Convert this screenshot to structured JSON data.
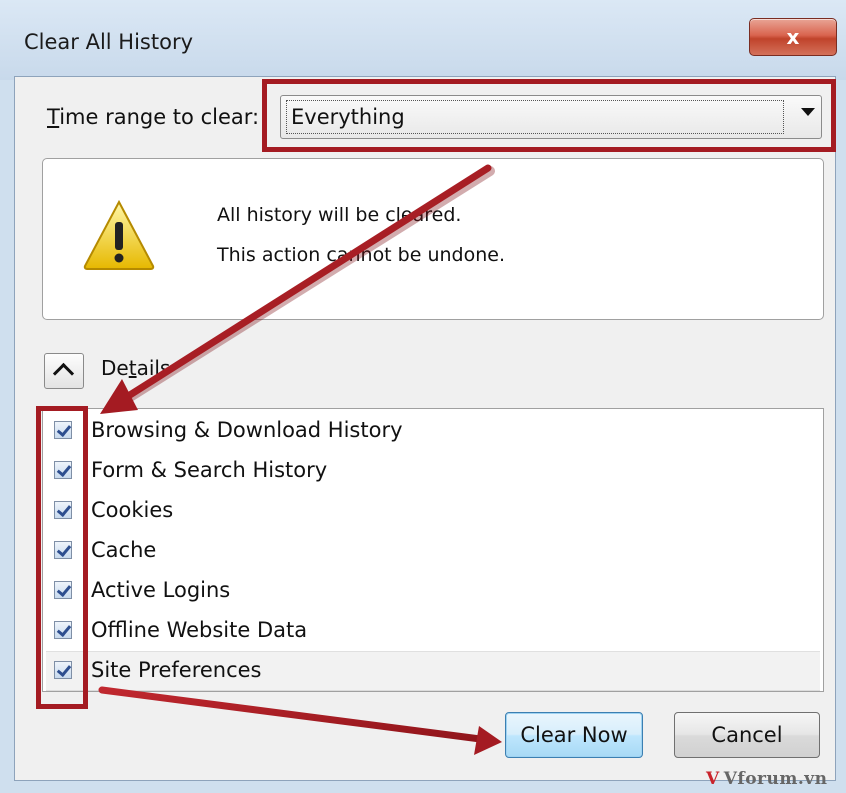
{
  "window": {
    "title": "Clear All History",
    "close_symbol": "x"
  },
  "time_range": {
    "label_prefix": "T",
    "label_rest": "ime range to clear:",
    "selected": "Everything"
  },
  "warning": {
    "icon": "warning-icon",
    "line1": "All history will be cleared.",
    "line2": "This action cannot be undone."
  },
  "details": {
    "icon": "chevron-up-icon",
    "label_pre": "De",
    "label_ul": "t",
    "label_post": "ails"
  },
  "items": [
    {
      "label": "Browsing & Download History",
      "checked": true
    },
    {
      "label": "Form & Search History",
      "checked": true
    },
    {
      "label": "Cookies",
      "checked": true
    },
    {
      "label": "Cache",
      "checked": true
    },
    {
      "label": "Active Logins",
      "checked": true
    },
    {
      "label": "Offline Website Data",
      "checked": true
    },
    {
      "label": "Site Preferences",
      "checked": true
    }
  ],
  "buttons": {
    "clear_now": "Clear Now",
    "cancel": "Cancel"
  },
  "watermark": {
    "logo": "V",
    "text": "Vforum.vn"
  },
  "colors": {
    "highlight": "#a41b22",
    "title_bg": "#cfdfee"
  }
}
